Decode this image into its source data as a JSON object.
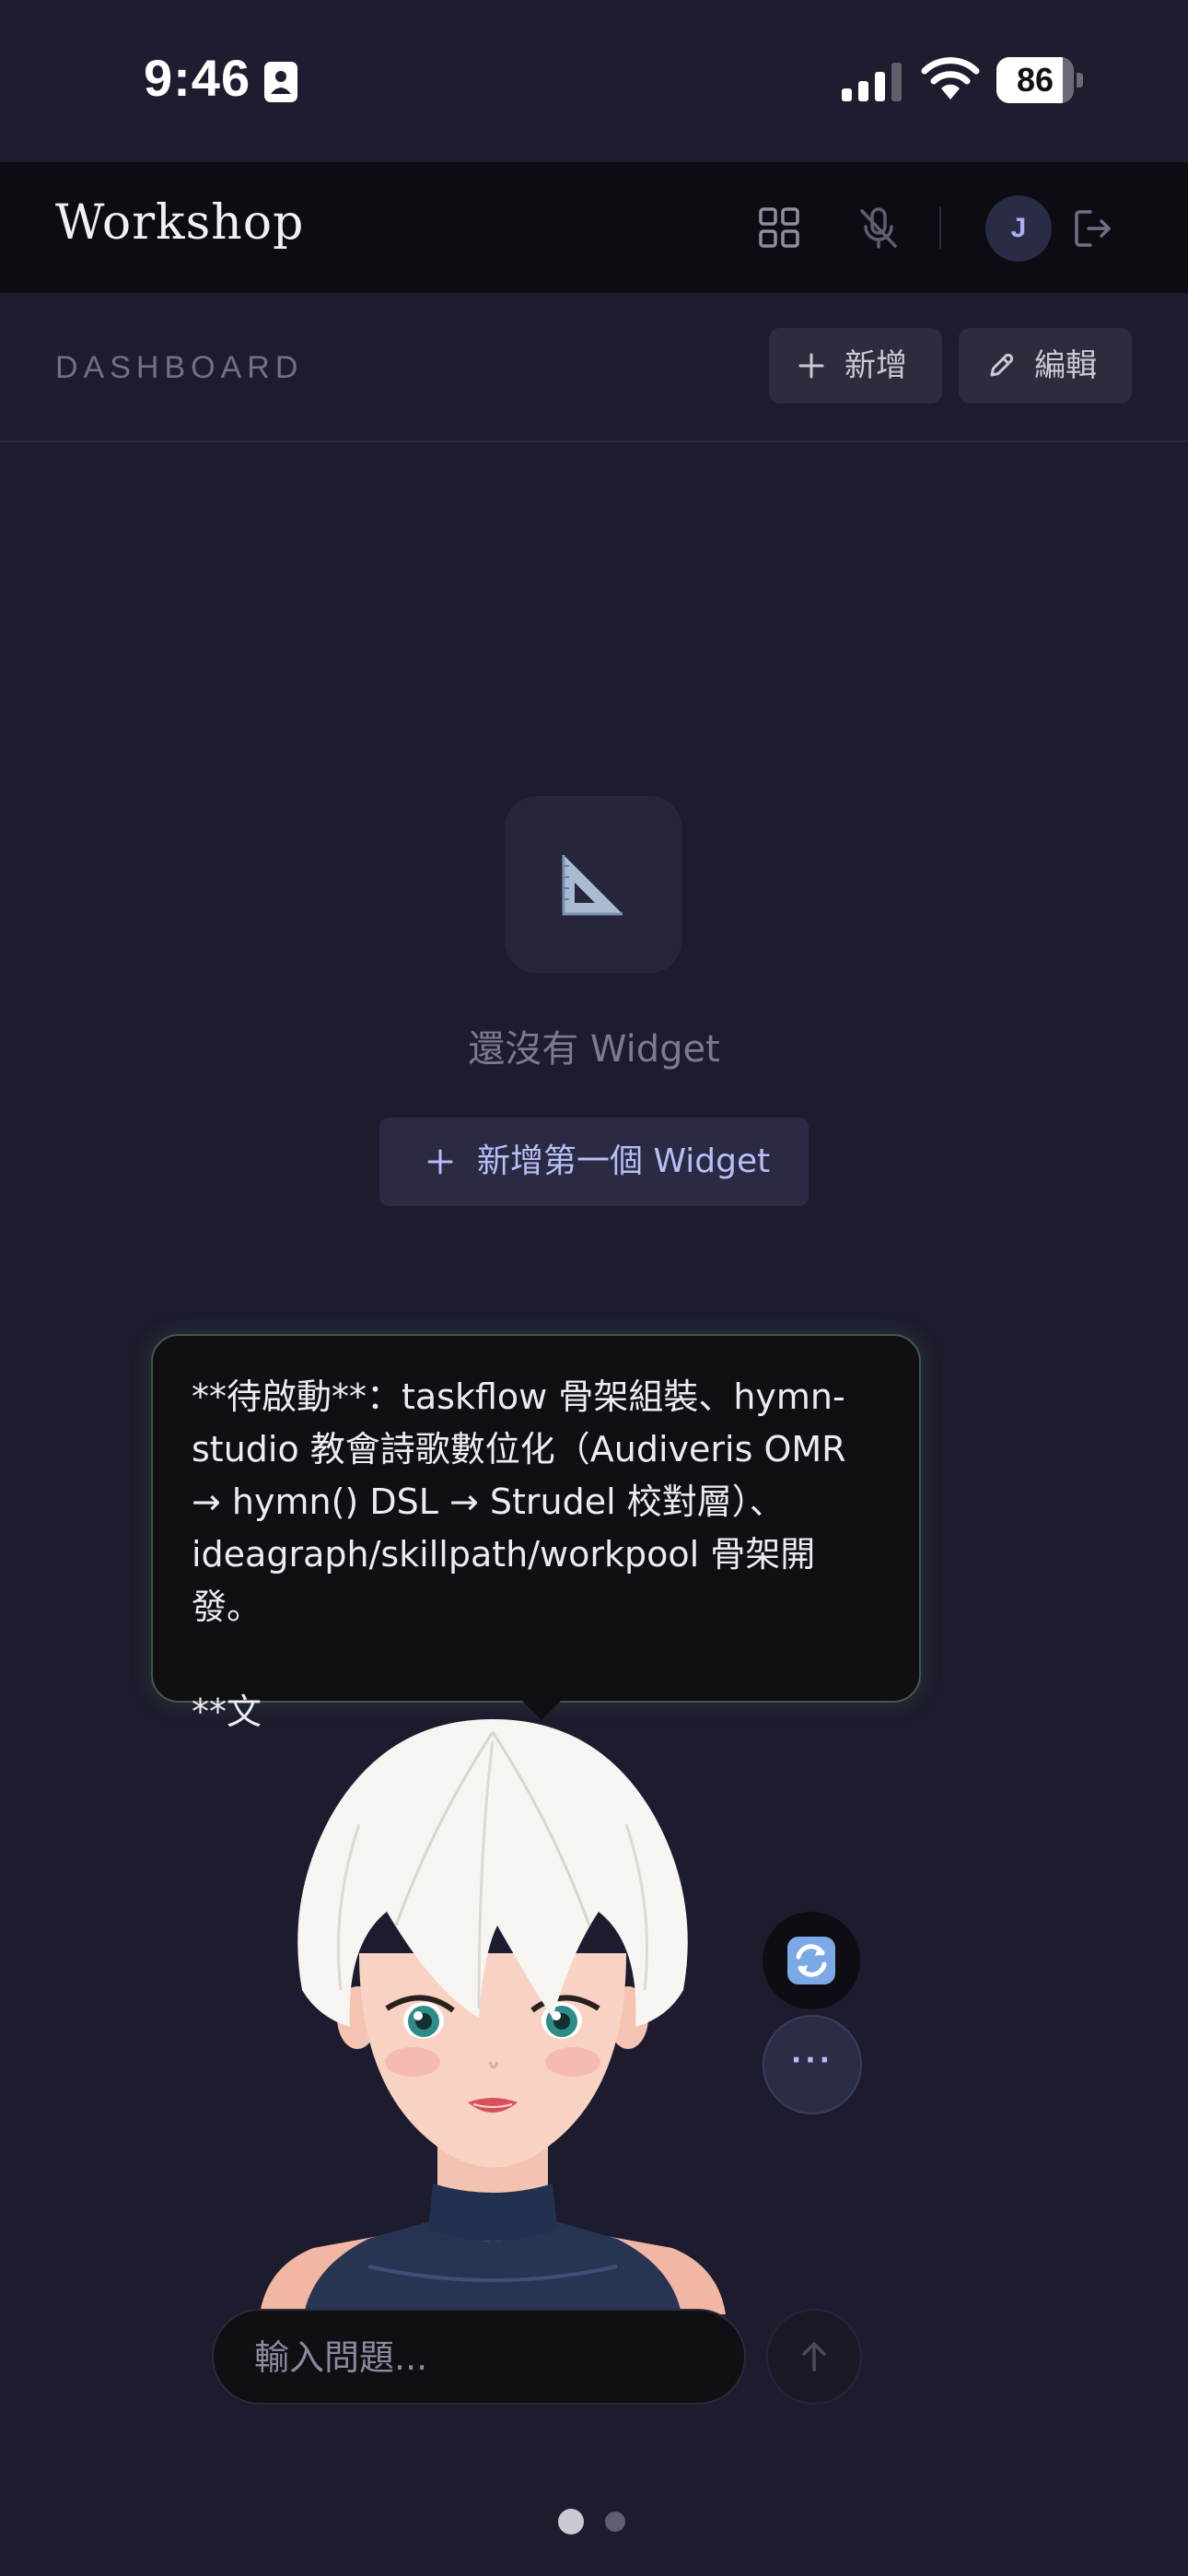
{
  "status_bar": {
    "time": "9:46",
    "battery": "86",
    "battery_level": 0.86
  },
  "header": {
    "title": "Workshop",
    "avatar_initial": "J"
  },
  "dashboard": {
    "title": "DASHBOARD",
    "add_label": "新增",
    "edit_label": "編輯"
  },
  "empty_state": {
    "text": "還沒有 Widget",
    "add_first_label": "新增第一個 Widget"
  },
  "bubble": {
    "line1": "**待啟動**：taskflow 骨架組裝、hymn-studio 教會詩歌數位化（Audiveris OMR → hymn() DSL → Strudel 校對層）、ideagraph/skillpath/workpool 骨架開發。",
    "line2": "**文"
  },
  "more_button": {
    "label": "···"
  },
  "chat": {
    "placeholder": "輸入問題..."
  },
  "colors": {
    "accent": "#a9aef5",
    "background": "#1c1c2e",
    "header": "#0c0c12",
    "bubble_border": "#3f5a45"
  }
}
